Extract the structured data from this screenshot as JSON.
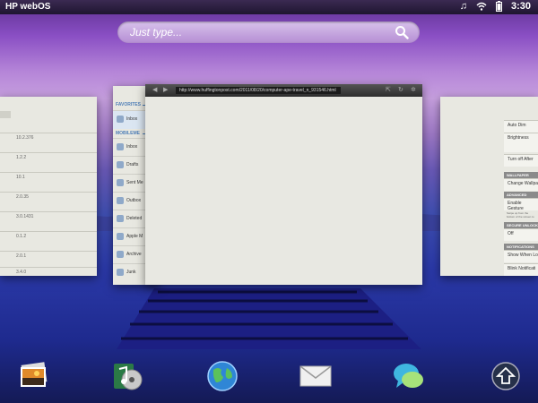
{
  "statusbar": {
    "title": "HP webOS",
    "time": "3:30"
  },
  "search": {
    "placeholder": "Just type..."
  },
  "left_card": {
    "values": [
      "10.2.376",
      "1.2.2",
      "10.1",
      "2.0.35",
      "3.0.1431",
      "0.1.2",
      "2.0.1",
      "3.4.0"
    ]
  },
  "mail_card": {
    "favorites_label": "FAVORITES",
    "mobileme_label": "MOBILEME",
    "folders": [
      "Inbox",
      "Inbox",
      "Drafts",
      "Sent Me",
      "Outbox",
      "Deleted",
      "Apple M",
      "Archive",
      "Junk"
    ]
  },
  "browser_card": {
    "url": "http://www.huffingtonpost.com/2011/08/20/computer-ape-travel_n_931546.html"
  },
  "settings_card": {
    "auto_dim": "Auto Dim",
    "brightness": "Brightness",
    "turn_off_after": "Turn off After",
    "section_wallpaper": "WALLPAPER",
    "change_wallpaper": "Change Wallpa",
    "section_advanced": "ADVANCED GESTU",
    "enable_gestures": "Enable Gesture",
    "gesture_note": "Swipe up from the bottom of the screen to open the Launcher.",
    "section_secure": "SECURE UNLOCK",
    "off": "Off",
    "section_notifications": "NOTIFICATIONS",
    "show_when_locked": "Show When Lo",
    "blink_notifications": "Blink Notificati"
  },
  "dock": {
    "items": [
      "photos-icon",
      "music-icon",
      "web-browser-icon",
      "email-icon",
      "messaging-icon",
      "launcher-icon"
    ]
  }
}
